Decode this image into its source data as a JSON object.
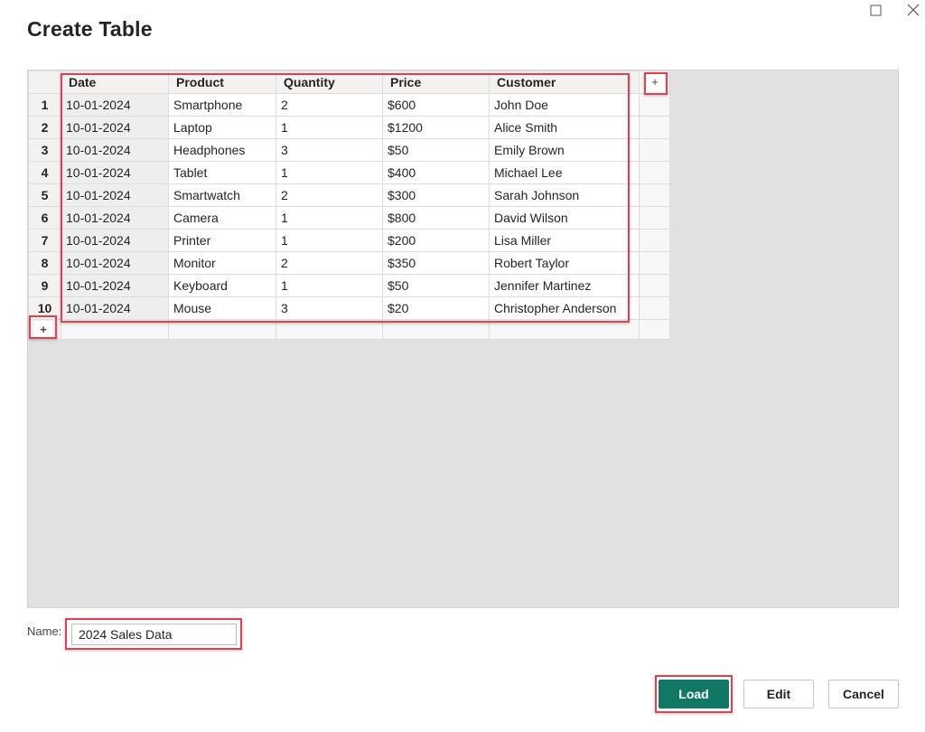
{
  "dialog": {
    "title": "Create Table",
    "maximize_icon": "maximize-icon",
    "close_icon": "close-icon"
  },
  "table": {
    "columns": [
      "Date",
      "Product",
      "Quantity",
      "Price",
      "Customer"
    ],
    "add_column_glyph": "+",
    "add_row_glyph": "+",
    "rows": [
      {
        "num": "1",
        "cells": [
          "10-01-2024",
          "Smartphone",
          "2",
          "$600",
          "John Doe"
        ]
      },
      {
        "num": "2",
        "cells": [
          "10-01-2024",
          "Laptop",
          "1",
          "$1200",
          "Alice Smith"
        ]
      },
      {
        "num": "3",
        "cells": [
          "10-01-2024",
          "Headphones",
          "3",
          "$50",
          "Emily Brown"
        ]
      },
      {
        "num": "4",
        "cells": [
          "10-01-2024",
          "Tablet",
          "1",
          "$400",
          "Michael Lee"
        ]
      },
      {
        "num": "5",
        "cells": [
          "10-01-2024",
          "Smartwatch",
          "2",
          "$300",
          "Sarah Johnson"
        ]
      },
      {
        "num": "6",
        "cells": [
          "10-01-2024",
          "Camera",
          "1",
          "$800",
          "David Wilson"
        ]
      },
      {
        "num": "7",
        "cells": [
          "10-01-2024",
          "Printer",
          "1",
          "$200",
          "Lisa Miller"
        ]
      },
      {
        "num": "8",
        "cells": [
          "10-01-2024",
          "Monitor",
          "2",
          "$350",
          "Robert Taylor"
        ]
      },
      {
        "num": "9",
        "cells": [
          "10-01-2024",
          "Keyboard",
          "1",
          "$50",
          "Jennifer Martinez"
        ]
      },
      {
        "num": "10",
        "cells": [
          "10-01-2024",
          "Mouse",
          "3",
          "$20",
          "Christopher Anderson"
        ]
      }
    ]
  },
  "name_field": {
    "label": "Name:",
    "value": "2024 Sales Data"
  },
  "buttons": {
    "load": "Load",
    "edit": "Edit",
    "cancel": "Cancel"
  },
  "colors": {
    "accent": "#117865",
    "highlight": "#e0404f"
  }
}
